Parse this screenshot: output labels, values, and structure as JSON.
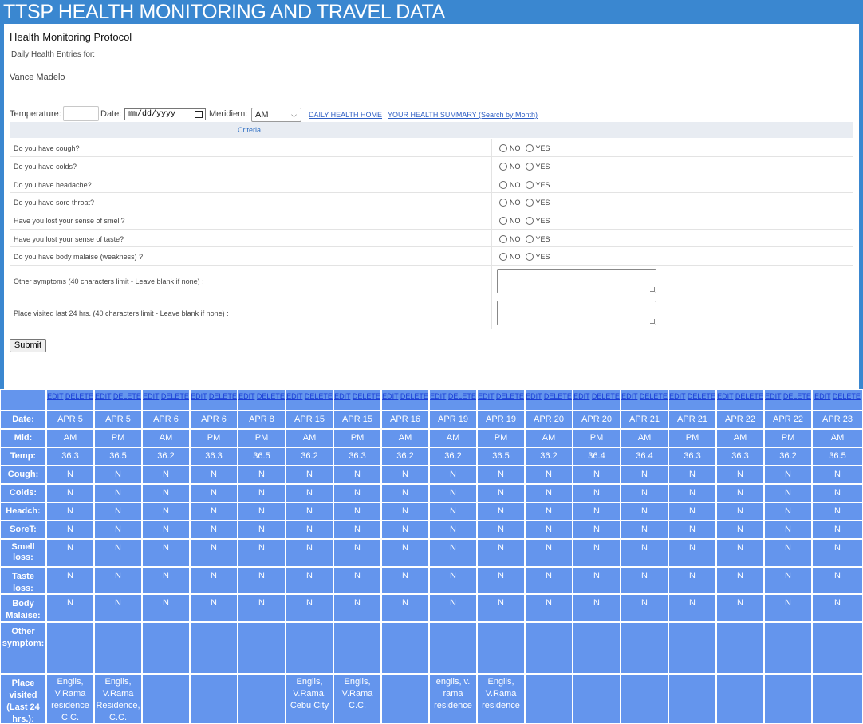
{
  "banner": {
    "title": "TTSP HEALTH MONITORING AND TRAVEL DATA"
  },
  "form": {
    "title": "Health Monitoring Protocol",
    "entries_for_label": "Daily Health Entries for:",
    "user_name": "Vance Madelo",
    "temperature_label": "Temperature:",
    "temperature_value": "",
    "date_label": "Date:",
    "date_placeholder": "mm/dd/yyyy",
    "meridiem_label": "Meridiem:",
    "meridiem_value": "AM",
    "links": [
      "DAILY HEALTH HOME",
      "YOUR HEALTH SUMMARY (Search by Month)"
    ],
    "criteria_header": "Criteria",
    "option_no": "NO",
    "option_yes": "YES",
    "questions": [
      "Do you have cough?",
      "Do you have colds?",
      "Do you have headache?",
      "Do you have sore throat?",
      "Have you lost your sense of smell?",
      "Have you lost your sense of taste?",
      "Do you have body malaise (weakness) ?"
    ],
    "text_questions": [
      "Other symptoms (40 characters limit - Leave blank if none) :",
      "Place visited last 24 hrs. (40 characters limit - Leave blank if none) :"
    ],
    "submit_label": "Submit"
  },
  "records": {
    "edit_label": "EDIT",
    "delete_label": "DELETE",
    "row_labels": [
      "Date:",
      "Mid:",
      "Temp:",
      "Cough:",
      "Colds:",
      "Headch:",
      "SoreT:",
      "Smell loss:",
      "Taste loss:",
      "Body Malaise:",
      "Other symptom:",
      "Place visited (Last 24 hrs.):"
    ],
    "entries": [
      {
        "date": "APR 5",
        "mid": "AM",
        "temp": "36.3",
        "cough": "N",
        "colds": "N",
        "headache": "N",
        "sore_throat": "N",
        "smell_loss": "N",
        "taste_loss": "N",
        "body_malaise": "N",
        "other": "",
        "place": "Englis, V.Rama residence C.C."
      },
      {
        "date": "APR 5",
        "mid": "PM",
        "temp": "36.5",
        "cough": "N",
        "colds": "N",
        "headache": "N",
        "sore_throat": "N",
        "smell_loss": "N",
        "taste_loss": "N",
        "body_malaise": "N",
        "other": "",
        "place": "Englis, V.Rama Residence, C.C."
      },
      {
        "date": "APR 6",
        "mid": "AM",
        "temp": "36.2",
        "cough": "N",
        "colds": "N",
        "headache": "N",
        "sore_throat": "N",
        "smell_loss": "N",
        "taste_loss": "N",
        "body_malaise": "N",
        "other": "",
        "place": ""
      },
      {
        "date": "APR 6",
        "mid": "PM",
        "temp": "36.3",
        "cough": "N",
        "colds": "N",
        "headache": "N",
        "sore_throat": "N",
        "smell_loss": "N",
        "taste_loss": "N",
        "body_malaise": "N",
        "other": "",
        "place": ""
      },
      {
        "date": "APR 8",
        "mid": "PM",
        "temp": "36.5",
        "cough": "N",
        "colds": "N",
        "headache": "N",
        "sore_throat": "N",
        "smell_loss": "N",
        "taste_loss": "N",
        "body_malaise": "N",
        "other": "",
        "place": ""
      },
      {
        "date": "APR 15",
        "mid": "AM",
        "temp": "36.2",
        "cough": "N",
        "colds": "N",
        "headache": "N",
        "sore_throat": "N",
        "smell_loss": "N",
        "taste_loss": "N",
        "body_malaise": "N",
        "other": "",
        "place": "Englis, V.Rama, Cebu City"
      },
      {
        "date": "APR 15",
        "mid": "PM",
        "temp": "36.3",
        "cough": "N",
        "colds": "N",
        "headache": "N",
        "sore_throat": "N",
        "smell_loss": "N",
        "taste_loss": "N",
        "body_malaise": "N",
        "other": "",
        "place": "Englis, V.Rama C.C."
      },
      {
        "date": "APR 16",
        "mid": "AM",
        "temp": "36.2",
        "cough": "N",
        "colds": "N",
        "headache": "N",
        "sore_throat": "N",
        "smell_loss": "N",
        "taste_loss": "N",
        "body_malaise": "N",
        "other": "",
        "place": ""
      },
      {
        "date": "APR 19",
        "mid": "AM",
        "temp": "36.2",
        "cough": "N",
        "colds": "N",
        "headache": "N",
        "sore_throat": "N",
        "smell_loss": "N",
        "taste_loss": "N",
        "body_malaise": "N",
        "other": "",
        "place": "englis, v. rama residence"
      },
      {
        "date": "APR 19",
        "mid": "PM",
        "temp": "36.5",
        "cough": "N",
        "colds": "N",
        "headache": "N",
        "sore_throat": "N",
        "smell_loss": "N",
        "taste_loss": "N",
        "body_malaise": "N",
        "other": "",
        "place": "Englis, V.Rama residence"
      },
      {
        "date": "APR 20",
        "mid": "AM",
        "temp": "36.2",
        "cough": "N",
        "colds": "N",
        "headache": "N",
        "sore_throat": "N",
        "smell_loss": "N",
        "taste_loss": "N",
        "body_malaise": "N",
        "other": "",
        "place": ""
      },
      {
        "date": "APR 20",
        "mid": "PM",
        "temp": "36.4",
        "cough": "N",
        "colds": "N",
        "headache": "N",
        "sore_throat": "N",
        "smell_loss": "N",
        "taste_loss": "N",
        "body_malaise": "N",
        "other": "",
        "place": ""
      },
      {
        "date": "APR 21",
        "mid": "AM",
        "temp": "36.4",
        "cough": "N",
        "colds": "N",
        "headache": "N",
        "sore_throat": "N",
        "smell_loss": "N",
        "taste_loss": "N",
        "body_malaise": "N",
        "other": "",
        "place": ""
      },
      {
        "date": "APR 21",
        "mid": "PM",
        "temp": "36.3",
        "cough": "N",
        "colds": "N",
        "headache": "N",
        "sore_throat": "N",
        "smell_loss": "N",
        "taste_loss": "N",
        "body_malaise": "N",
        "other": "",
        "place": ""
      },
      {
        "date": "APR 22",
        "mid": "AM",
        "temp": "36.3",
        "cough": "N",
        "colds": "N",
        "headache": "N",
        "sore_throat": "N",
        "smell_loss": "N",
        "taste_loss": "N",
        "body_malaise": "N",
        "other": "",
        "place": ""
      },
      {
        "date": "APR 22",
        "mid": "PM",
        "temp": "36.2",
        "cough": "N",
        "colds": "N",
        "headache": "N",
        "sore_throat": "N",
        "smell_loss": "N",
        "taste_loss": "N",
        "body_malaise": "N",
        "other": "",
        "place": ""
      },
      {
        "date": "APR 23",
        "mid": "AM",
        "temp": "36.5",
        "cough": "N",
        "colds": "N",
        "headache": "N",
        "sore_throat": "N",
        "smell_loss": "N",
        "taste_loss": "N",
        "body_malaise": "N",
        "other": "",
        "place": ""
      }
    ]
  }
}
